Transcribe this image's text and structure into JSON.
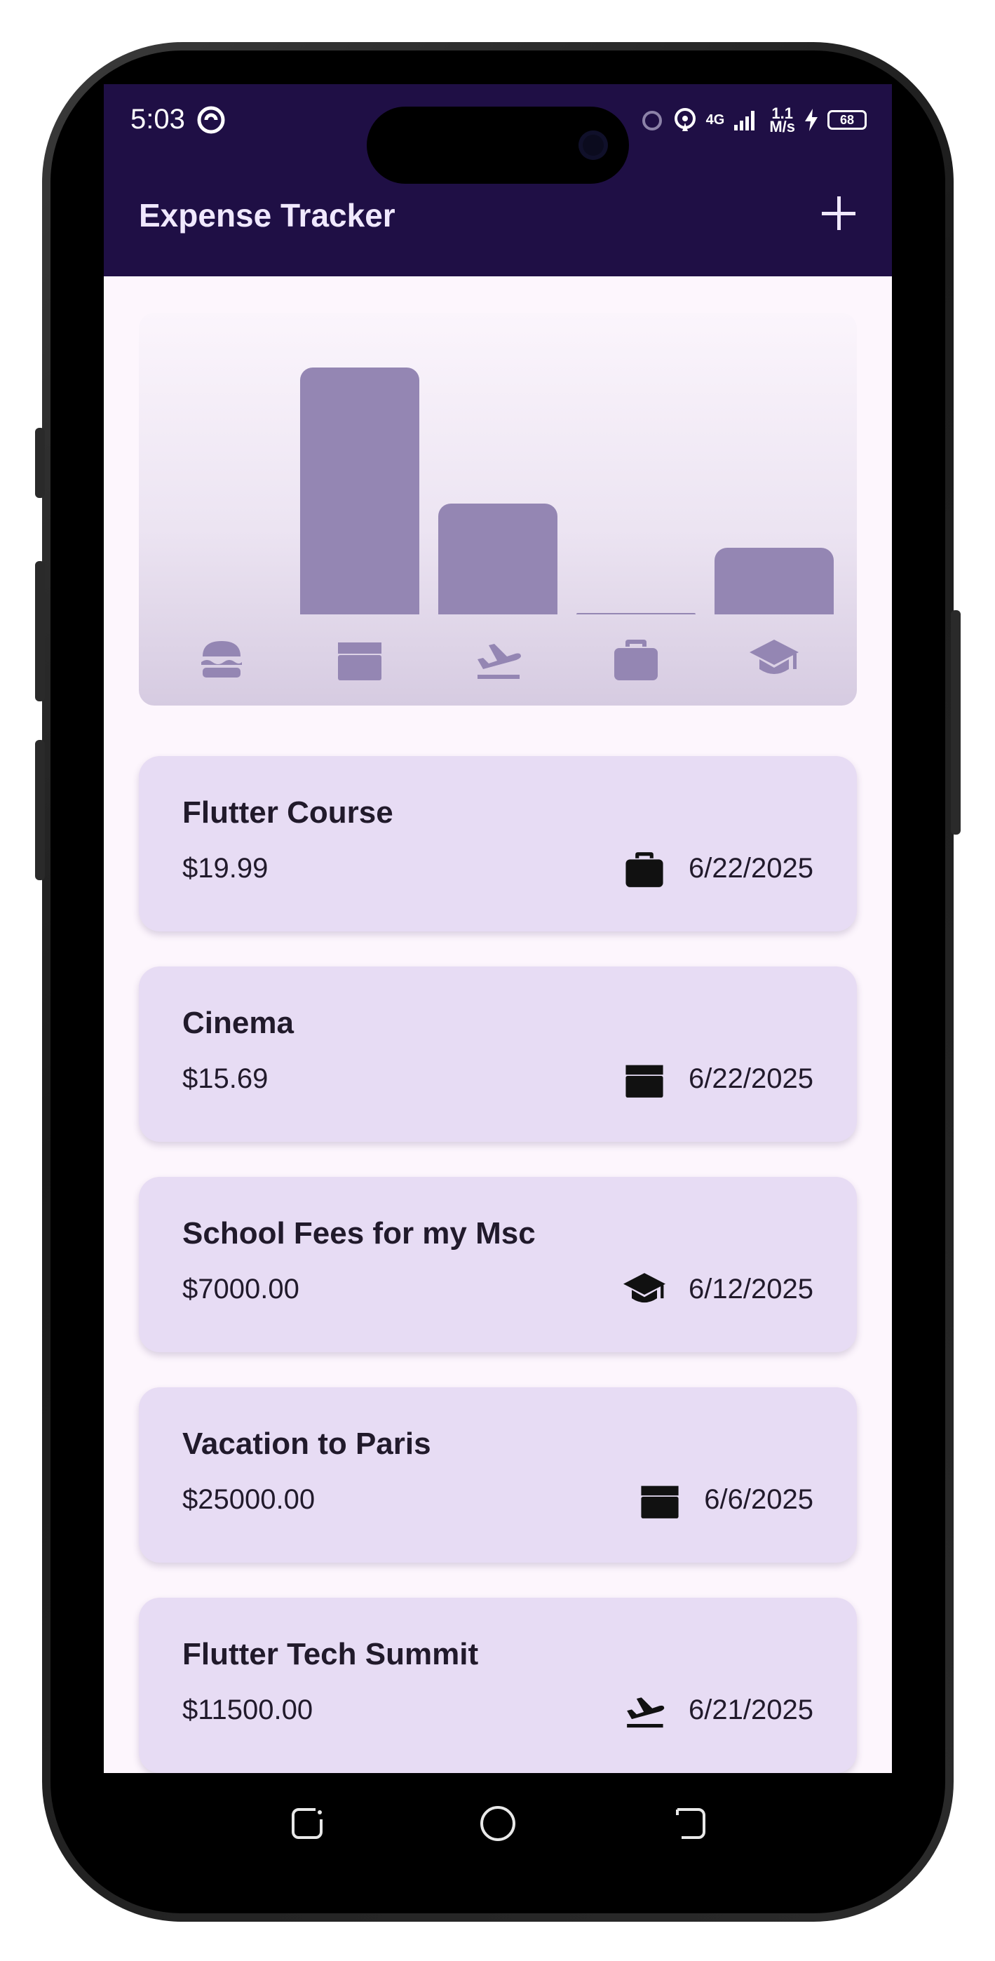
{
  "status_bar": {
    "time": "5:03",
    "network_speed_top": "1.1",
    "network_speed_bottom": "M/s",
    "battery": "68",
    "network_type": "4G"
  },
  "app_bar": {
    "title": "Expense Tracker",
    "add_icon": "plus-icon"
  },
  "chart_data": {
    "type": "bar",
    "categories": [
      "food",
      "leisure",
      "travel",
      "work",
      "education"
    ],
    "category_icons": [
      "burger-icon",
      "clapperboard-icon",
      "airplane-departure-icon",
      "briefcase-icon",
      "graduation-cap-icon"
    ],
    "values": [
      0,
      1.0,
      0.45,
      0.005,
      0.27
    ],
    "bar_color": "#9486b3"
  },
  "expenses": [
    {
      "title": "Flutter Course",
      "amount": "$19.99",
      "date": "6/22/2025",
      "icon": "briefcase-icon"
    },
    {
      "title": "Cinema",
      "amount": "$15.69",
      "date": "6/22/2025",
      "icon": "clapperboard-icon"
    },
    {
      "title": "School Fees for my Msc",
      "amount": "$7000.00",
      "date": "6/12/2025",
      "icon": "graduation-cap-icon"
    },
    {
      "title": "Vacation to Paris",
      "amount": "$25000.00",
      "date": "6/6/2025",
      "icon": "clapperboard-icon"
    },
    {
      "title": "Flutter Tech Summit",
      "amount": "$11500.00",
      "date": "6/21/2025",
      "icon": "airplane-departure-icon"
    }
  ],
  "colors": {
    "app_bar": "#1f0f45",
    "card": "#e7dcf4",
    "background": "#fdf6fd",
    "accent": "#9486b3"
  },
  "nav_bar": {
    "recents_icon": "recents-icon",
    "home_icon": "home-circle-icon",
    "back_icon": "back-icon"
  }
}
